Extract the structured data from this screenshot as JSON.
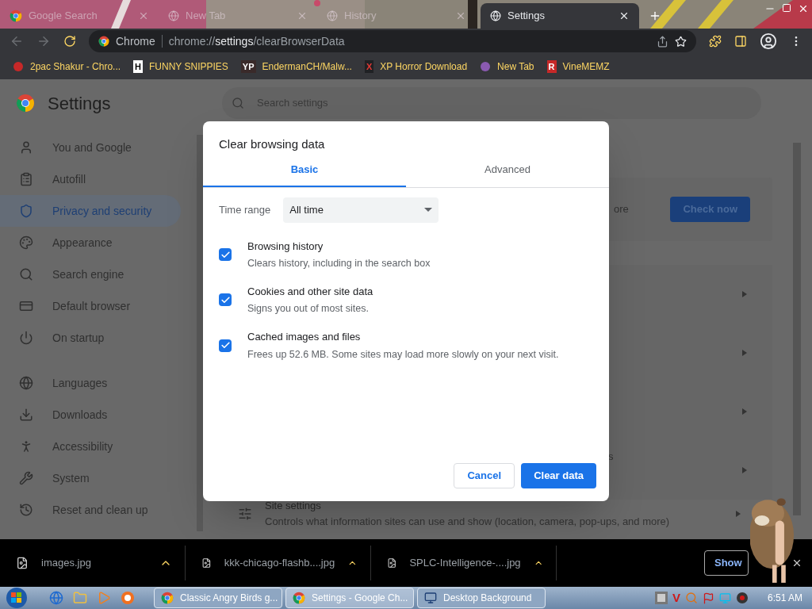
{
  "browser_tabs": [
    {
      "title": "Google Search",
      "selected": false
    },
    {
      "title": "New Tab",
      "selected": false
    },
    {
      "title": "History",
      "selected": false
    },
    {
      "title": "Settings",
      "selected": true
    }
  ],
  "omnibox": {
    "site": "Chrome",
    "url_prefix": "chrome://",
    "url_bold": "settings",
    "url_rest": "/clearBrowserData"
  },
  "bookmarks": [
    {
      "label": "2pac Shakur - Chro..."
    },
    {
      "label": "FUNNY SNIPPIES",
      "icon_text": "H"
    },
    {
      "label": "EndermanCH/Malw...",
      "icon_text": "YP"
    },
    {
      "label": "XP Horror Download",
      "icon_text": "X"
    },
    {
      "label": "New Tab"
    },
    {
      "label": "VineMEMZ",
      "icon_text": "R"
    }
  ],
  "settings": {
    "title": "Settings",
    "search_placeholder": "Search settings",
    "sidebar": [
      {
        "label": "You and Google",
        "selected": false
      },
      {
        "label": "Autofill",
        "selected": false
      },
      {
        "label": "Privacy and security",
        "selected": true
      },
      {
        "label": "Appearance",
        "selected": false
      },
      {
        "label": "Search engine",
        "selected": false
      },
      {
        "label": "Default browser",
        "selected": false
      },
      {
        "label": "On startup",
        "selected": false
      },
      {
        "label": "Languages",
        "selected": false
      },
      {
        "label": "Downloads",
        "selected": false
      },
      {
        "label": "Accessibility",
        "selected": false
      },
      {
        "label": "System",
        "selected": false
      },
      {
        "label": "Reset and clean up",
        "selected": false
      }
    ],
    "card_fragment": "ore",
    "check_button": "Check now",
    "row_fragment": "s",
    "site_settings": {
      "title": "Site settings",
      "description": "Controls what information sites can use and show (location, camera, pop-ups, and more)"
    }
  },
  "dialog": {
    "title": "Clear browsing data",
    "tabs": [
      {
        "label": "Basic",
        "selected": true
      },
      {
        "label": "Advanced",
        "selected": false
      }
    ],
    "time_range": {
      "label": "Time range",
      "value": "All time"
    },
    "options": [
      {
        "title": "Browsing history",
        "description": "Clears history, including in the search box",
        "checked": true
      },
      {
        "title": "Cookies and other site data",
        "description": "Signs you out of most sites.",
        "checked": true
      },
      {
        "title": "Cached images and files",
        "description": "Frees up 52.6 MB. Some sites may load more slowly on your next visit.",
        "checked": true
      }
    ],
    "cancel": "Cancel",
    "confirm": "Clear data"
  },
  "downloads": [
    {
      "name": "images.jpg"
    },
    {
      "name": "kkk-chicago-flashb....jpg"
    },
    {
      "name": "SPLC-Intelligence-....jpg"
    }
  ],
  "show_all": "Show",
  "taskbar": {
    "tasks": [
      {
        "title": "Classic Angry Birds g...",
        "selected": false
      },
      {
        "title": "Settings - Google Ch...",
        "selected": true
      },
      {
        "title": "Desktop Background",
        "selected": false
      }
    ],
    "tray_letter": "V",
    "clock": "6:51 AM"
  }
}
